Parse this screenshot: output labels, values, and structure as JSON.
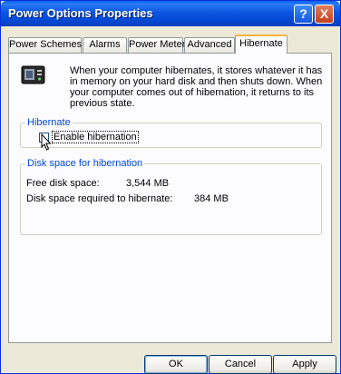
{
  "window": {
    "title": "Power Options Properties",
    "help_label": "?",
    "close_label": "X"
  },
  "tabs": [
    {
      "label": "Power Schemes"
    },
    {
      "label": "Alarms"
    },
    {
      "label": "Power Meter"
    },
    {
      "label": "Advanced"
    },
    {
      "label": "Hibernate"
    }
  ],
  "active_tab": "Hibernate",
  "description": "When your computer hibernates, it stores whatever it has in memory on your hard disk and then shuts down. When your computer comes out of hibernation, it returns to its previous state.",
  "hibernate_group": {
    "legend": "Hibernate",
    "checkbox_label": "Enable hibernation",
    "checked": false
  },
  "disk_group": {
    "legend": "Disk space for hibernation",
    "free_label": "Free disk space:",
    "free_value": "3,544 MB",
    "required_label": "Disk space required to hibernate:",
    "required_value": "384 MB"
  },
  "buttons": {
    "ok": "OK",
    "cancel": "Cancel",
    "apply": "Apply"
  }
}
